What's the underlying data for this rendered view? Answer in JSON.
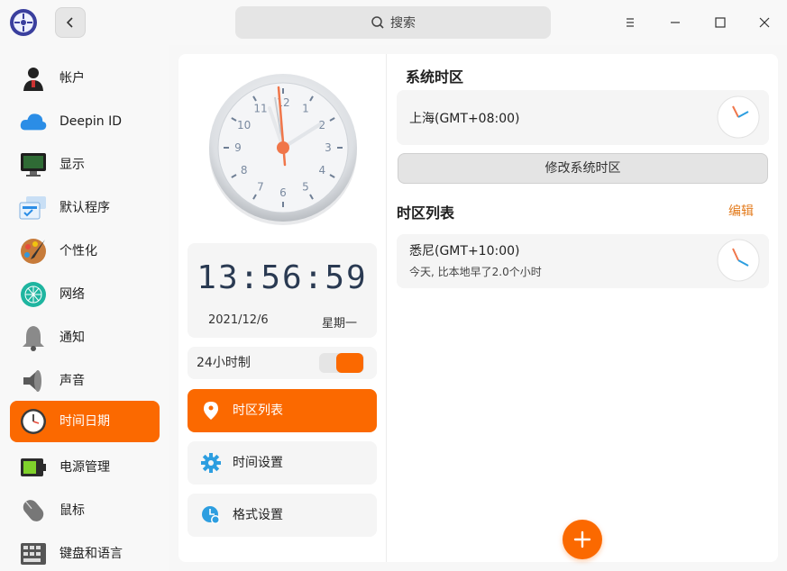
{
  "titlebar": {
    "search_placeholder": "搜索",
    "logo_icon": "deepin-control-center-icon",
    "back_icon": "chevron-left-icon",
    "menu_icon": "hamburger-menu-icon",
    "minimize_icon": "minimize-icon",
    "maximize_icon": "maximize-icon",
    "close_icon": "close-icon"
  },
  "sidebar": {
    "items": [
      {
        "label": "帐户",
        "icon": "account-icon"
      },
      {
        "label": "Deepin ID",
        "icon": "cloud-icon"
      },
      {
        "label": "显示",
        "icon": "display-icon"
      },
      {
        "label": "默认程序",
        "icon": "default-apps-icon"
      },
      {
        "label": "个性化",
        "icon": "personalization-icon"
      },
      {
        "label": "网络",
        "icon": "network-icon"
      },
      {
        "label": "通知",
        "icon": "bell-icon"
      },
      {
        "label": "声音",
        "icon": "speaker-icon"
      },
      {
        "label": "时间日期",
        "icon": "clock-icon",
        "active": true
      },
      {
        "label": "电源管理",
        "icon": "battery-icon"
      },
      {
        "label": "鼠标",
        "icon": "mouse-icon"
      },
      {
        "label": "键盘和语言",
        "icon": "keyboard-icon"
      }
    ]
  },
  "clock": {
    "digital_time": "13:56:59",
    "date": "2021/12/6",
    "weekday": "星期一",
    "analog_numbers": [
      "12",
      "1",
      "2",
      "3",
      "4",
      "5",
      "6",
      "7",
      "8",
      "9",
      "10",
      "11"
    ]
  },
  "hour24": {
    "label": "24小时制",
    "enabled": true
  },
  "menu": {
    "items": [
      {
        "label": "时区列表",
        "icon": "location-pin-icon",
        "active": true
      },
      {
        "label": "时间设置",
        "icon": "gear-icon"
      },
      {
        "label": "格式设置",
        "icon": "format-clock-icon"
      }
    ]
  },
  "system_tz": {
    "title": "系统时区",
    "zone": "上海(GMT+08:00)",
    "change_label": "修改系统时区"
  },
  "tz_list": {
    "title": "时区列表",
    "edit_label": "编辑",
    "zones": [
      {
        "name": "悉尼(GMT+10:00)",
        "detail": "今天, 比本地早了2.0个小时"
      }
    ]
  },
  "colors": {
    "accent": "#fb6900",
    "edit_link": "#e37b1d"
  },
  "add_icon": "plus-icon"
}
